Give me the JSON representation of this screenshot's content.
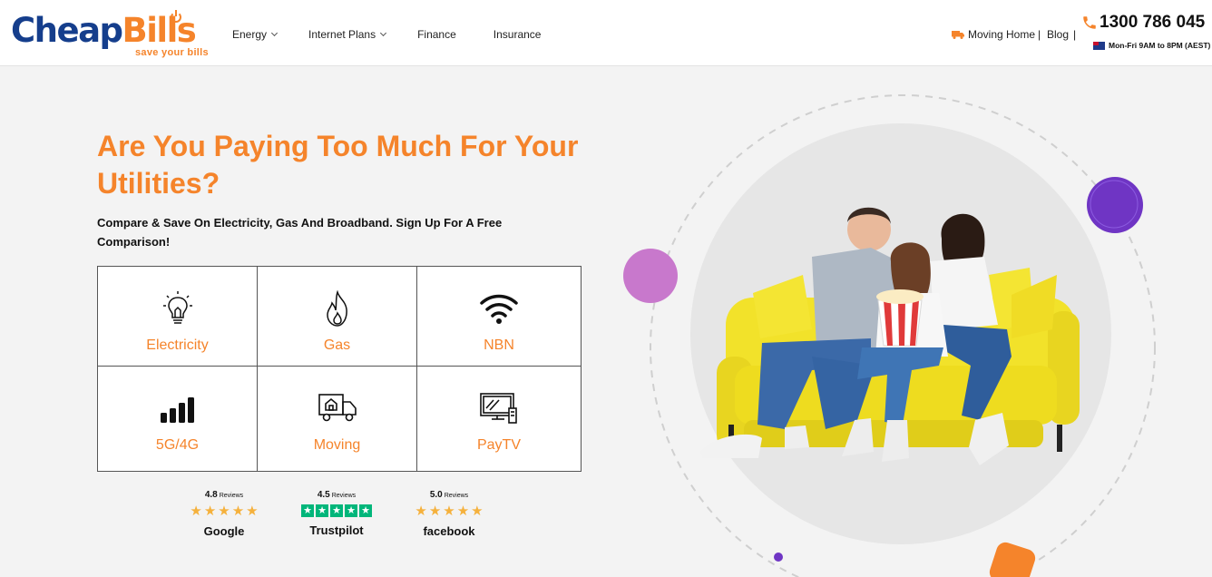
{
  "brand": {
    "logo_main_a": "Cheap",
    "logo_main_b": "Bills",
    "tagline": "save your bills"
  },
  "nav": [
    {
      "label": "Energy",
      "dropdown": true
    },
    {
      "label": "Internet Plans",
      "dropdown": true
    },
    {
      "label": "Finance",
      "dropdown": false
    },
    {
      "label": "Insurance",
      "dropdown": false
    }
  ],
  "top_right": {
    "moving_home": "Moving Home",
    "separator": "|",
    "blog": "Blog",
    "phone": "1300 786 045",
    "hours": "Mon-Fri 9AM to 8PM (AEST)"
  },
  "hero": {
    "title": "Are You Paying Too Much For Your Utilities?",
    "subtitle": "Compare & Save On Electricity, Gas And Broadband. Sign Up For A Free Comparison!"
  },
  "services": [
    {
      "label": "Electricity",
      "icon": "lightbulb-icon"
    },
    {
      "label": "Gas",
      "icon": "flame-icon"
    },
    {
      "label": "NBN",
      "icon": "wifi-icon"
    },
    {
      "label": "5G/4G",
      "icon": "signal-bars-icon"
    },
    {
      "label": "Moving",
      "icon": "moving-truck-icon"
    },
    {
      "label": "PayTV",
      "icon": "tv-icon"
    }
  ],
  "ratings": [
    {
      "score": "4.8",
      "suffix": "Reviews",
      "source": "Google",
      "stars": 5
    },
    {
      "score": "4.5",
      "suffix": "Reviews",
      "source": "Trustpilot",
      "stars": 5
    },
    {
      "score": "5.0",
      "suffix": "Reviews",
      "source": "facebook",
      "stars": 5
    }
  ],
  "colors": {
    "accent": "#f5842b",
    "brand_blue": "#153e8c",
    "purple": "#6f35c4",
    "pink": "#c878cc",
    "sofa_yellow": "#f2e22a",
    "trustpilot": "#00b67a"
  }
}
